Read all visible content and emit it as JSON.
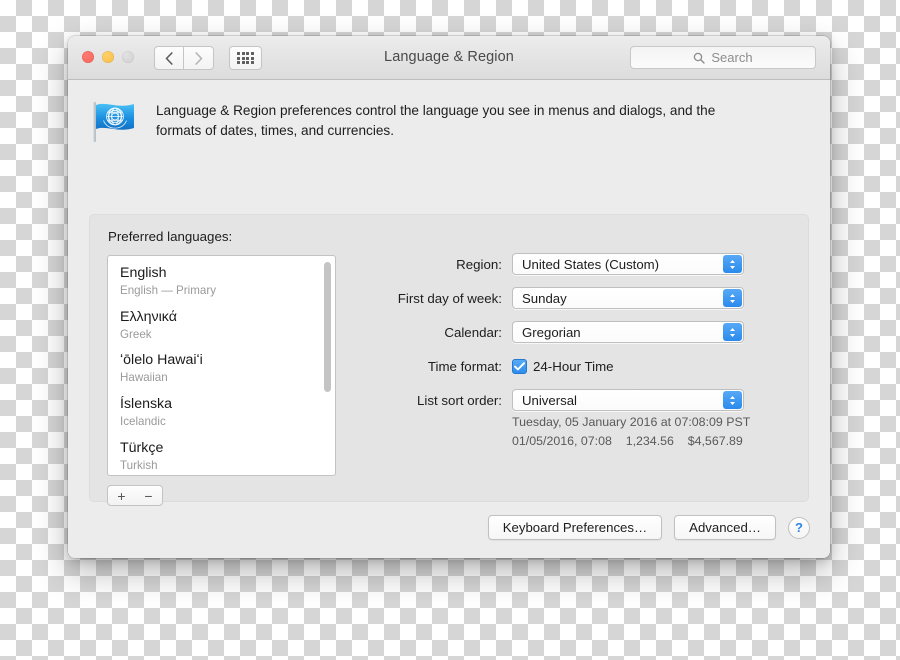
{
  "window": {
    "title": "Language & Region",
    "traffic_lights": [
      "close",
      "minimize",
      "zoom"
    ],
    "nav": {
      "back_icon": "chevron-left-icon",
      "forward_icon": "chevron-right-icon",
      "grid_icon": "show-all-grid-icon"
    },
    "search": {
      "placeholder": "Search",
      "icon": "search-icon"
    }
  },
  "blurb": {
    "icon": "un-flag-icon",
    "text": "Language & Region preferences control the language you see in menus and dialogs, and the formats of dates, times, and currencies."
  },
  "panel": {
    "label": "Preferred languages:",
    "languages": [
      {
        "name": "English",
        "sub": "English — Primary"
      },
      {
        "name": "Ελληνικά",
        "sub": "Greek"
      },
      {
        "name": "ʻōlelo Hawaiʻi",
        "sub": "Hawaiian"
      },
      {
        "name": "Íslenska",
        "sub": "Icelandic"
      },
      {
        "name": "Türkçe",
        "sub": "Turkish"
      }
    ],
    "add_label": "+",
    "remove_label": "−"
  },
  "form": {
    "rows": [
      {
        "label": "Region:",
        "value": "United States (Custom)",
        "type": "popup"
      },
      {
        "label": "First day of week:",
        "value": "Sunday",
        "type": "popup"
      },
      {
        "label": "Calendar:",
        "value": "Gregorian",
        "type": "popup"
      },
      {
        "label": "Time format:",
        "value": "24-Hour Time",
        "type": "checkbox",
        "checked": true
      },
      {
        "label": "List sort order:",
        "value": "Universal",
        "type": "popup"
      }
    ]
  },
  "samples": {
    "line1": "Tuesday, 05 January 2016 at 07:08:09 PST",
    "date_short": "01/05/2016, 07:08",
    "number": "1,234.56",
    "currency": "$4,567.89"
  },
  "footer": {
    "keyboard_preferences": "Keyboard Preferences…",
    "advanced": "Advanced…",
    "help": "?"
  },
  "colors": {
    "accent_blue": "#2d8cee",
    "window_bg": "#ececec",
    "panel_bg": "#e4e4e4",
    "close_red": "#f4645c",
    "minimize_yellow": "#f8bd45",
    "zoom_gray": "#cfcfcf"
  }
}
